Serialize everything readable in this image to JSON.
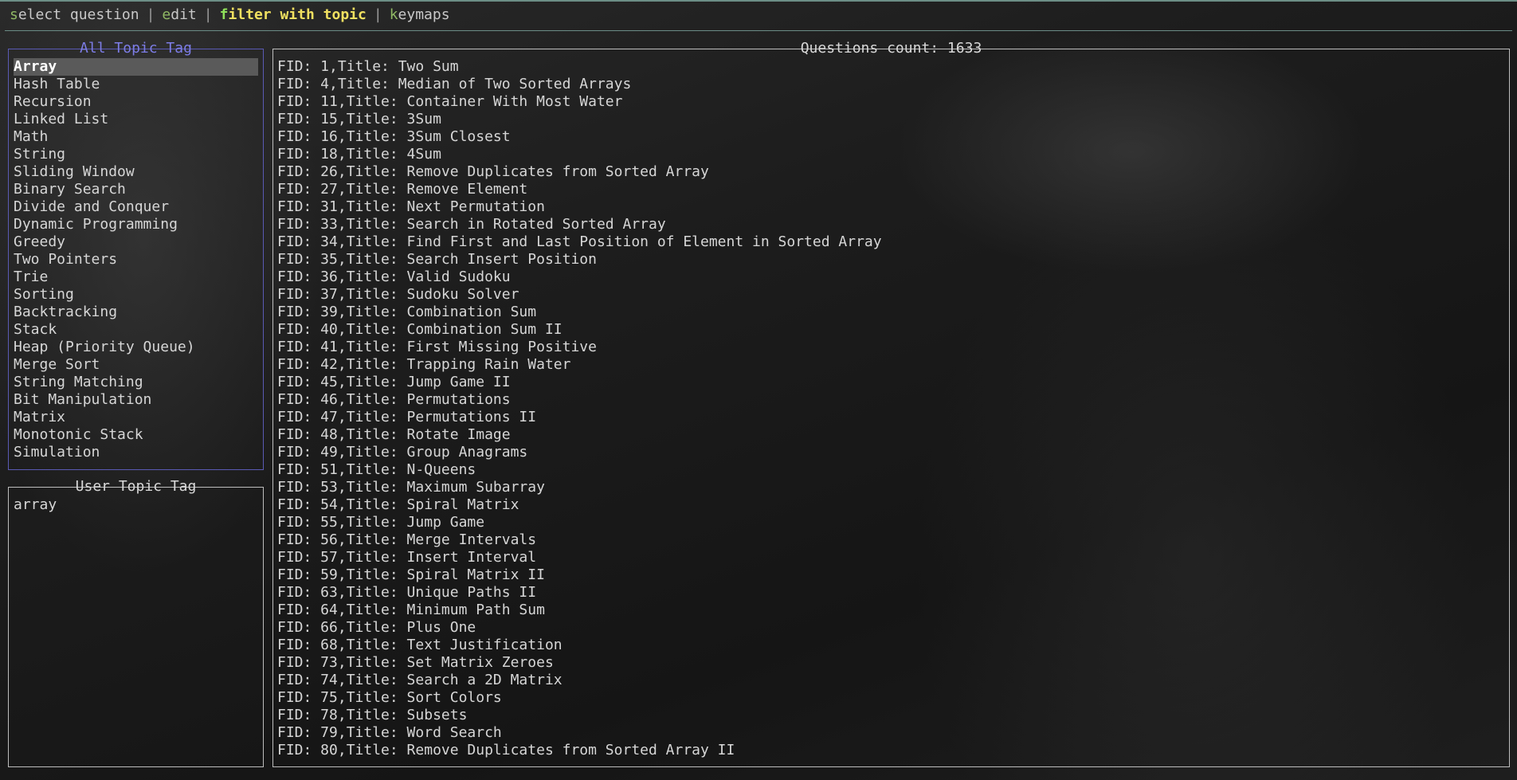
{
  "tabs": {
    "select": {
      "hot": "s",
      "rest": "elect question"
    },
    "edit": {
      "hot": "e",
      "rest": "dit"
    },
    "filter": {
      "hot": "f",
      "rest": "ilter with topic"
    },
    "keymaps": {
      "hot": "k",
      "rest": "eymaps"
    },
    "active": "filter with topic",
    "separator": "|"
  },
  "all_topic_tag": {
    "title": "All Topic Tag",
    "selected": "Array",
    "items": [
      "Array",
      "Hash Table",
      "Recursion",
      "Linked List",
      "Math",
      "String",
      "Sliding Window",
      "Binary Search",
      "Divide and Conquer",
      "Dynamic Programming",
      "Greedy",
      "Two Pointers",
      "Trie",
      "Sorting",
      "Backtracking",
      "Stack",
      "Heap (Priority Queue)",
      "Merge Sort",
      "String Matching",
      "Bit Manipulation",
      "Matrix",
      "Monotonic Stack",
      "Simulation"
    ]
  },
  "user_topic_tag": {
    "title": "User Topic Tag",
    "items": [
      "array"
    ]
  },
  "questions": {
    "title": "Questions count: 1633",
    "items": [
      "FID: 1,Title: Two Sum",
      "FID: 4,Title: Median of Two Sorted Arrays",
      "FID: 11,Title: Container With Most Water",
      "FID: 15,Title: 3Sum",
      "FID: 16,Title: 3Sum Closest",
      "FID: 18,Title: 4Sum",
      "FID: 26,Title: Remove Duplicates from Sorted Array",
      "FID: 27,Title: Remove Element",
      "FID: 31,Title: Next Permutation",
      "FID: 33,Title: Search in Rotated Sorted Array",
      "FID: 34,Title: Find First and Last Position of Element in Sorted Array",
      "FID: 35,Title: Search Insert Position",
      "FID: 36,Title: Valid Sudoku",
      "FID: 37,Title: Sudoku Solver",
      "FID: 39,Title: Combination Sum",
      "FID: 40,Title: Combination Sum II",
      "FID: 41,Title: First Missing Positive",
      "FID: 42,Title: Trapping Rain Water",
      "FID: 45,Title: Jump Game II",
      "FID: 46,Title: Permutations",
      "FID: 47,Title: Permutations II",
      "FID: 48,Title: Rotate Image",
      "FID: 49,Title: Group Anagrams",
      "FID: 51,Title: N-Queens",
      "FID: 53,Title: Maximum Subarray",
      "FID: 54,Title: Spiral Matrix",
      "FID: 55,Title: Jump Game",
      "FID: 56,Title: Merge Intervals",
      "FID: 57,Title: Insert Interval",
      "FID: 59,Title: Spiral Matrix II",
      "FID: 63,Title: Unique Paths II",
      "FID: 64,Title: Minimum Path Sum",
      "FID: 66,Title: Plus One",
      "FID: 68,Title: Text Justification",
      "FID: 73,Title: Set Matrix Zeroes",
      "FID: 74,Title: Search a 2D Matrix",
      "FID: 75,Title: Sort Colors",
      "FID: 78,Title: Subsets",
      "FID: 79,Title: Word Search",
      "FID: 80,Title: Remove Duplicates from Sorted Array II"
    ]
  },
  "colors": {
    "active_tab": "#f0e060",
    "hotkey": "#8fb864",
    "all_topic_border": "#5a5ab4",
    "selection_bg": "#5a5a5a"
  }
}
